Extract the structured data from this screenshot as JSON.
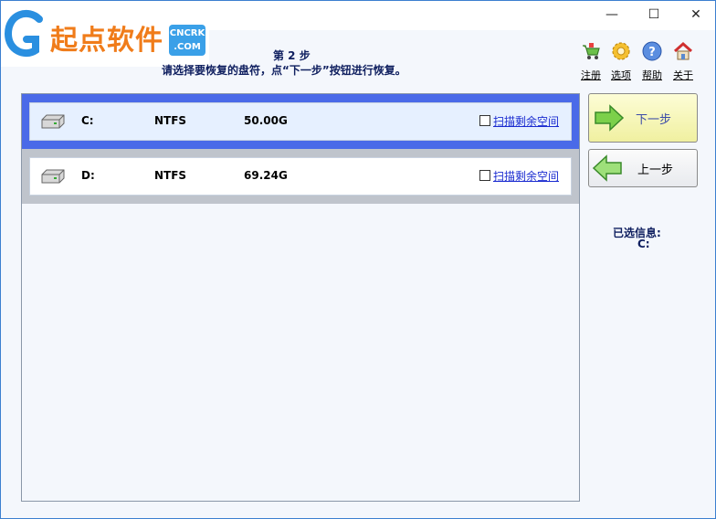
{
  "window": {
    "minimize": "—",
    "maximize": "☐",
    "close": "✕"
  },
  "logo": {
    "text": "起点软件",
    "badge_line1": "CNCRK",
    "badge_line2": ".COM"
  },
  "header": {
    "step_title": "第 2 步",
    "step_desc": "请选择要恢复的盘符，点“下一步”按钮进行恢复。"
  },
  "toolbar": {
    "register": "注册",
    "options": "选项",
    "help": "帮助",
    "about": "关于"
  },
  "drives": [
    {
      "letter": "C:",
      "fs": "NTFS",
      "size": "50.00G",
      "scan_label": "扫描剩余空间",
      "selected": true
    },
    {
      "letter": "D:",
      "fs": "NTFS",
      "size": "69.24G",
      "scan_label": "扫描剩余空间",
      "selected": false
    }
  ],
  "buttons": {
    "next": "下一步",
    "prev": "上一步"
  },
  "selection": {
    "label": "已选信息:",
    "value": "C:"
  },
  "colors": {
    "selected_row": "#4a6ae8",
    "normal_row": "#bfc4cc",
    "link": "#1a2bd0",
    "accent_text": "#102060"
  }
}
